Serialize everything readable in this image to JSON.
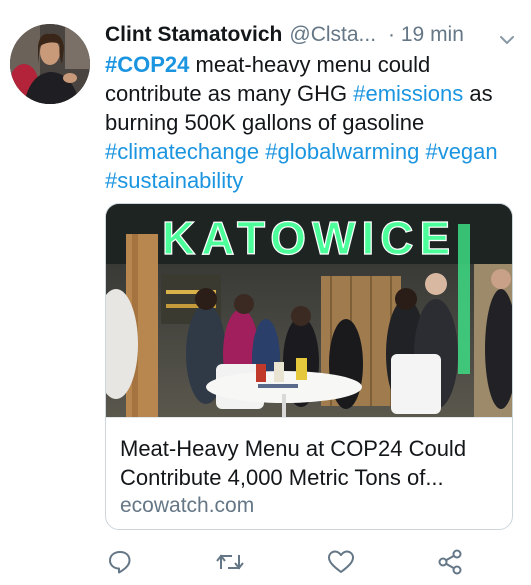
{
  "tweet": {
    "author_name": "Clint Stamatovich",
    "author_handle": "@Clsta...",
    "timestamp": "· 19 min",
    "text_parts": [
      {
        "type": "hashtag",
        "value": "#COP24"
      },
      {
        "type": "text",
        "value": " meat-heavy menu could contribute as many GHG "
      },
      {
        "type": "hashtag",
        "value": "#emissions"
      },
      {
        "type": "text",
        "value": " as burning 500K gallons of gasoline "
      },
      {
        "type": "hashtag",
        "value": "#climatechange"
      },
      {
        "type": "text",
        "value": " "
      },
      {
        "type": "hashtag",
        "value": "#globalwarming"
      },
      {
        "type": "text",
        "value": " "
      },
      {
        "type": "hashtag",
        "value": "#vegan"
      },
      {
        "type": "text",
        "value": " "
      },
      {
        "type": "hashtag",
        "value": "#sustainability"
      }
    ]
  },
  "card": {
    "photo_sign_text": "KATOWICE",
    "title": "Meat-Heavy Menu at COP24 Could Contribute 4,000 Metric Tons of...",
    "domain": "ecowatch.com"
  },
  "actions": [
    {
      "name": "reply",
      "icon": "reply-icon"
    },
    {
      "name": "retweet",
      "icon": "retweet-icon"
    },
    {
      "name": "like",
      "icon": "heart-icon"
    },
    {
      "name": "share",
      "icon": "share-icon"
    }
  ],
  "colors": {
    "link": "#1b95e0",
    "secondary_text": "#657786",
    "primary_text": "#14171a",
    "border": "#ccd6dd",
    "sign_green": "#3ddc84"
  }
}
